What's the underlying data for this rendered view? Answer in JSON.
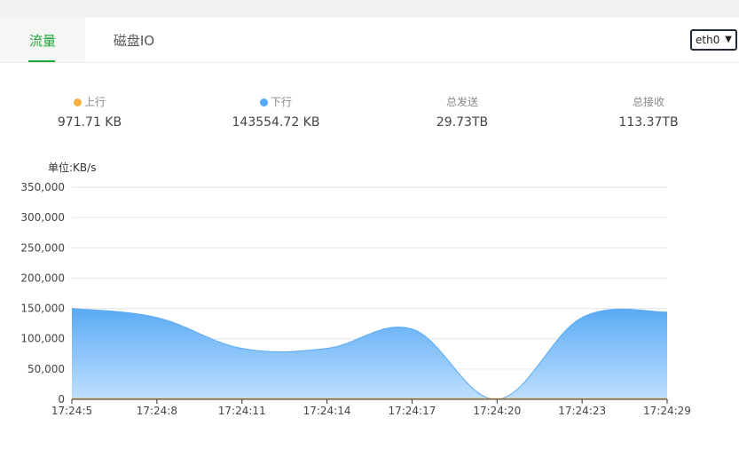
{
  "tabs": [
    {
      "label": "流量",
      "active": true
    },
    {
      "label": "磁盘IO",
      "active": false
    }
  ],
  "interface_select": {
    "value": "eth0"
  },
  "stats": [
    {
      "label": "上行",
      "value": "971.71 KB",
      "dot_color": "#f5b041"
    },
    {
      "label": "下行",
      "value": "143554.72 KB",
      "dot_color": "#52a9ff"
    },
    {
      "label": "总发送",
      "value": "29.73TB"
    },
    {
      "label": "总接收",
      "value": "113.37TB"
    }
  ],
  "chart_unit": "单位:KB/s",
  "chart_data": {
    "type": "area",
    "x": [
      "17:24:5",
      "17:24:8",
      "17:24:11",
      "17:24:14",
      "17:24:17",
      "17:24:20",
      "17:24:23",
      "17:24:29"
    ],
    "ylim": [
      0,
      350000
    ],
    "yticks": [
      "0",
      "50,000",
      "100,000",
      "150,000",
      "200,000",
      "250,000",
      "300,000",
      "350,000"
    ],
    "grid": true,
    "series": [
      {
        "values": [
          150000,
          135000,
          84000,
          84000,
          116000,
          0,
          135000,
          144000
        ],
        "color": "#5aaaf5"
      },
      {
        "values": [
          1000,
          1000,
          1000,
          1000,
          1000,
          1000,
          1000,
          1000
        ],
        "color": "#f5b041"
      }
    ]
  }
}
